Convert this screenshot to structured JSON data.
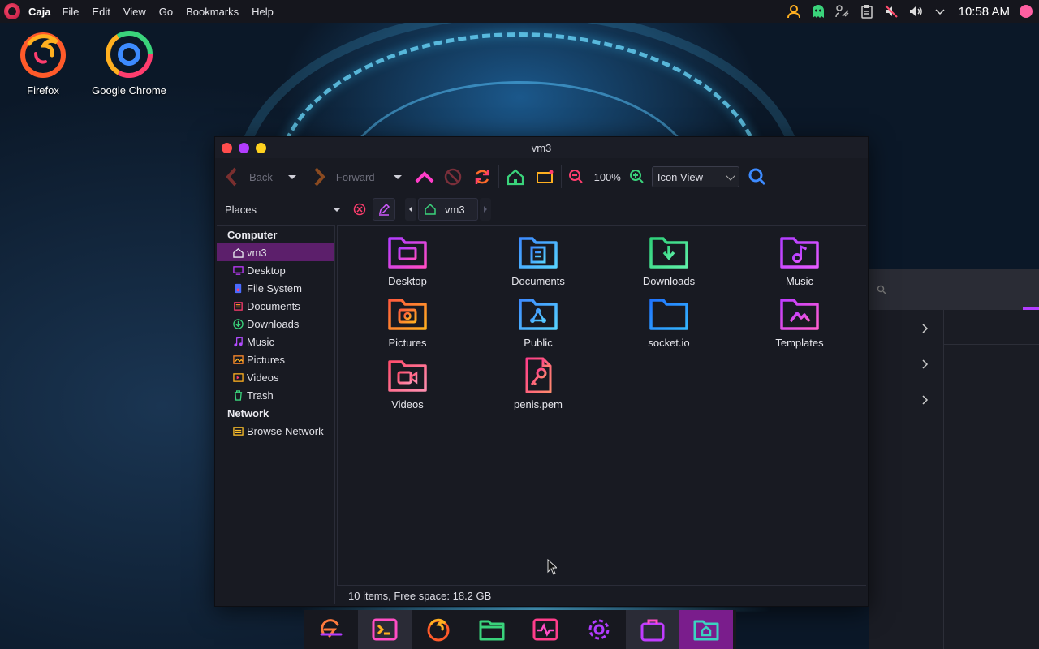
{
  "top_panel": {
    "app_name": "Caja",
    "menu": [
      "File",
      "Edit",
      "View",
      "Go",
      "Bookmarks",
      "Help"
    ],
    "clock": "10:58 AM",
    "tray_icons": [
      "user-icon",
      "ghost-icon",
      "network-icon",
      "clipboard-icon",
      "mic-muted-icon",
      "volume-icon",
      "chevron-down-icon"
    ]
  },
  "desktop": {
    "icons": [
      {
        "label": "Firefox",
        "icon": "firefox-icon"
      },
      {
        "label": "Google Chrome",
        "icon": "chrome-icon"
      }
    ]
  },
  "window": {
    "title": "vm3",
    "toolbar": {
      "back_label": "Back",
      "forward_label": "Forward",
      "zoom_level": "100%",
      "view_mode": "Icon View"
    },
    "places_label": "Places",
    "breadcrumb": {
      "current": "vm3"
    },
    "sidebar": {
      "computer_header": "Computer",
      "computer_items": [
        {
          "label": "vm3",
          "icon": "home-icon",
          "color": "#e8e8f0",
          "selected": true
        },
        {
          "label": "Desktop",
          "icon": "desktop-icon",
          "color": "#c03cff"
        },
        {
          "label": "File System",
          "icon": "filesystem-icon",
          "color": "#4a6bff"
        },
        {
          "label": "Documents",
          "icon": "documents-icon",
          "color": "#ff3d6e"
        },
        {
          "label": "Downloads",
          "icon": "downloads-icon",
          "color": "#3ad37b"
        },
        {
          "label": "Music",
          "icon": "music-icon",
          "color": "#b24cff"
        },
        {
          "label": "Pictures",
          "icon": "pictures-icon",
          "color": "#ff8a2a"
        },
        {
          "label": "Videos",
          "icon": "videos-icon",
          "color": "#ffb020"
        },
        {
          "label": "Trash",
          "icon": "trash-icon",
          "color": "#3ad37b"
        }
      ],
      "network_header": "Network",
      "network_items": [
        {
          "label": "Browse Network",
          "icon": "network-icon",
          "color": "#ffc02a"
        }
      ]
    },
    "files": [
      {
        "label": "Desktop",
        "icon": "folder-desktop-icon",
        "color_a": "#b23cff",
        "color_b": "#ff4dc4"
      },
      {
        "label": "Documents",
        "icon": "folder-documents-icon",
        "color_a": "#3d8bff",
        "color_b": "#57d2ff"
      },
      {
        "label": "Downloads",
        "icon": "folder-downloads-icon",
        "color_a": "#2fd07a",
        "color_b": "#5ff0a8"
      },
      {
        "label": "Music",
        "icon": "folder-music-icon",
        "color_a": "#b23cff",
        "color_b": "#e65bff"
      },
      {
        "label": "Pictures",
        "icon": "folder-pictures-icon",
        "color_a": "#ff5a3d",
        "color_b": "#ffb020"
      },
      {
        "label": "Public",
        "icon": "folder-public-icon",
        "color_a": "#3d8bff",
        "color_b": "#57d2ff"
      },
      {
        "label": "socket.io",
        "icon": "folder-icon",
        "color_a": "#1f74ff",
        "color_b": "#35b6ff"
      },
      {
        "label": "Templates",
        "icon": "folder-templates-icon",
        "color_a": "#c03cff",
        "color_b": "#ff5fd0"
      },
      {
        "label": "Videos",
        "icon": "folder-videos-icon",
        "color_a": "#ff4d6d",
        "color_b": "#ff8fb0"
      },
      {
        "label": "penis.pem",
        "icon": "key-file-icon",
        "color_a": "#ff3d8a",
        "color_b": "#ff8a6e"
      }
    ],
    "status": "10 items, Free space: 18.2 GB"
  },
  "dock": {
    "items": [
      {
        "name": "menu-icon",
        "color": "#ff7a3d"
      },
      {
        "name": "terminal-icon",
        "color": "#ff4dc4"
      },
      {
        "name": "firefox-icon",
        "color": "#ff6a2a"
      },
      {
        "name": "files-icon",
        "color": "#3ad37b"
      },
      {
        "name": "monitor-icon",
        "color": "#ff3d8a"
      },
      {
        "name": "settings-icon",
        "color": "#b23cff"
      },
      {
        "name": "software-icon",
        "color": "#c03cff"
      },
      {
        "name": "home-folder-icon",
        "color": "#3ad3c0"
      }
    ]
  }
}
